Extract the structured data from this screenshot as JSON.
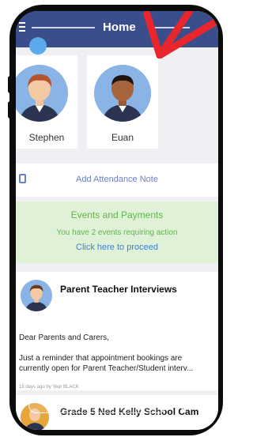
{
  "header": {
    "title": "Home"
  },
  "children": [
    {
      "name": "Stephen"
    },
    {
      "name": "Euan"
    }
  ],
  "attendance": {
    "label": "Add Attendance Note"
  },
  "events": {
    "title": "Events and Payments",
    "subtitle": "You have 2 events requiring action",
    "link": "Click here to proceed"
  },
  "post": {
    "title": "Parent Teacher Interviews",
    "greeting": "Dear Parents and Carers,",
    "body_line1": "Just a reminder that appointment bookings are",
    "body_line2": "currently open for Parent Teacher/Student interv...",
    "meta": "15 days ago by Year BLACK"
  },
  "post2": {
    "title": "Grade 5 Ned Kelly School Cam"
  },
  "colors": {
    "header": "#3a4e8c",
    "events_bg": "#dff2d8",
    "events_text": "#63b34a",
    "link": "#3b7fd8",
    "annotation": "#e8262c",
    "dot": "#5aa9ea"
  }
}
